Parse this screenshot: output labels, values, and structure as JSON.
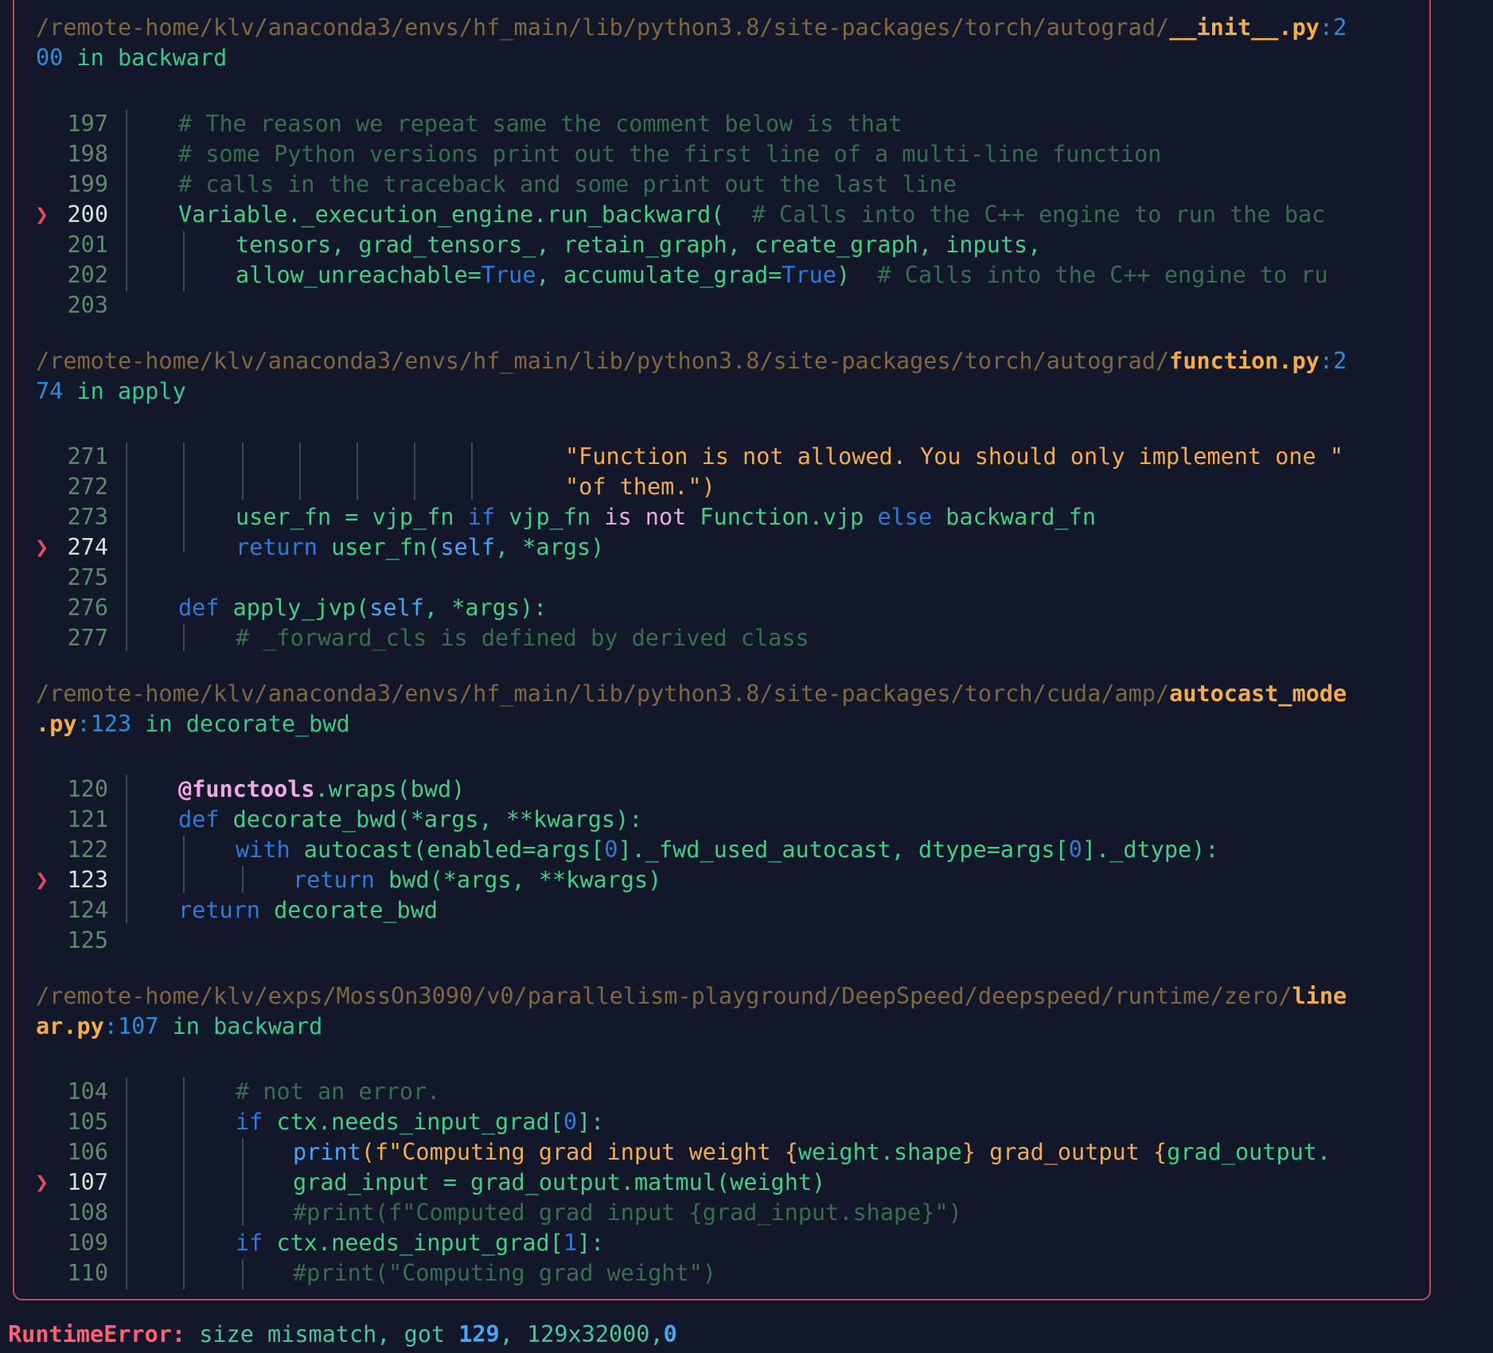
{
  "frames": [
    {
      "path_dir": "/remote-home/klv/anaconda3/envs/hf_main/lib/python3.8/site-packages/torch/autograd/",
      "file": "__init__.py",
      "line_a": ":2",
      "line_b": "00",
      "func": " in backward",
      "lines": [
        {
          "n": "197",
          "code": "# The reason we repeat same the comment below is that"
        },
        {
          "n": "198",
          "code": "# some Python versions print out the first line of a multi-line function"
        },
        {
          "n": "199",
          "code": "# calls in the traceback and some print out the last line"
        },
        {
          "n": "200",
          "marker": "❯",
          "code_a": "Variable._execution_engine.run_backward(",
          "code_b": "  # Calls into the C++ engine to run the bac"
        },
        {
          "n": "201",
          "code": "tensors, grad_tensors_, retain_graph, create_graph, inputs,"
        },
        {
          "n": "202",
          "code_a": "allow_unreachable=",
          "kw1": "True",
          "code_b": ", accumulate_grad=",
          "kw2": "True",
          "code_c": ")",
          "comment": "  # Calls into the C++ engine to ru"
        },
        {
          "n": "203",
          "code": ""
        }
      ]
    },
    {
      "path_dir": "/remote-home/klv/anaconda3/envs/hf_main/lib/python3.8/site-packages/torch/autograd/",
      "file": "function.py",
      "line_a": ":2",
      "line_b": "74",
      "func": " in apply",
      "lines": [
        {
          "n": "271",
          "code": "\"Function is not allowed. You should only implement one \""
        },
        {
          "n": "272",
          "code": "\"of them.\")"
        },
        {
          "n": "273",
          "code_a": "user_fn = vjp_fn ",
          "kw1": "if",
          "code_b": " vjp_fn ",
          "op": "is not",
          "code_c": " Function.vjp ",
          "kw2": "else",
          "code_d": " backward_fn"
        },
        {
          "n": "274",
          "marker": "❯",
          "kw": "return",
          "code_a": " user_fn(",
          "self": "self",
          "code_b": ", *args)"
        },
        {
          "n": "275",
          "code": ""
        },
        {
          "n": "276",
          "kw": "def",
          "code_a": " apply_jvp(",
          "self": "self",
          "code_b": ", *args):"
        },
        {
          "n": "277",
          "code": "# _forward_cls is defined by derived class"
        }
      ]
    },
    {
      "path_dir": "/remote-home/klv/anaconda3/envs/hf_main/lib/python3.8/site-packages/torch/cuda/amp/",
      "file": "autocast_mode",
      "file2": ".py",
      "line_b": ":123",
      "func": " in decorate_bwd",
      "lines": [
        {
          "n": "120",
          "deco": "@functools",
          "code": ".wraps(bwd)"
        },
        {
          "n": "121",
          "kw": "def",
          "code": " decorate_bwd(*args, **kwargs):"
        },
        {
          "n": "122",
          "kw": "with",
          "code_a": " autocast(enabled=args[",
          "n1": "0",
          "code_b": "]._fwd_used_autocast, dtype=args[",
          "n2": "0",
          "code_c": "]._dtype):"
        },
        {
          "n": "123",
          "marker": "❯",
          "kw": "return",
          "code": " bwd(*args, **kwargs)"
        },
        {
          "n": "124",
          "kw": "return",
          "code": " decorate_bwd"
        },
        {
          "n": "125",
          "code": ""
        }
      ]
    },
    {
      "path_dir": "/remote-home/klv/exps/MossOn3090/v0/parallelism-playground/DeepSpeed/deepspeed/runtime/zero/",
      "file": "line",
      "file2": "ar.py",
      "line_b": ":107",
      "func": " in backward",
      "lines": [
        {
          "n": "104",
          "code": "# not an error."
        },
        {
          "n": "105",
          "kw": "if",
          "code_a": " ctx.needs_input_grad[",
          "n1": "0",
          "code_b": "]:"
        },
        {
          "n": "106",
          "fn": "print",
          "code_a": "(f\"Computing grad input weight {",
          "code_b": "weight.shape",
          "code_c": "} grad_output {",
          "code_d": "grad_output."
        },
        {
          "n": "107",
          "marker": "❯",
          "code": "grad_input = grad_output.matmul(weight)"
        },
        {
          "n": "108",
          "code": "#print(f\"Computed grad input {grad_input.shape}\")"
        },
        {
          "n": "109",
          "kw": "if",
          "code_a": " ctx.needs_input_grad[",
          "n1": "1",
          "code_b": "]:"
        },
        {
          "n": "110",
          "code": "#print(\"Computing grad weight\")"
        }
      ]
    }
  ],
  "error": {
    "type": "RuntimeError:",
    "msg_a": " size mismatch, got ",
    "num": "129",
    "msg_b": ", 129x32000,",
    "num2": "0"
  },
  "colors": {
    "background": "#13172a",
    "border": "#c9475a",
    "marker": "#e8485c",
    "path": "#80673f",
    "file": "#f3ac49",
    "keyword": "#2d7bd6",
    "code": "#3fcf86",
    "comment": "#386e4f"
  }
}
